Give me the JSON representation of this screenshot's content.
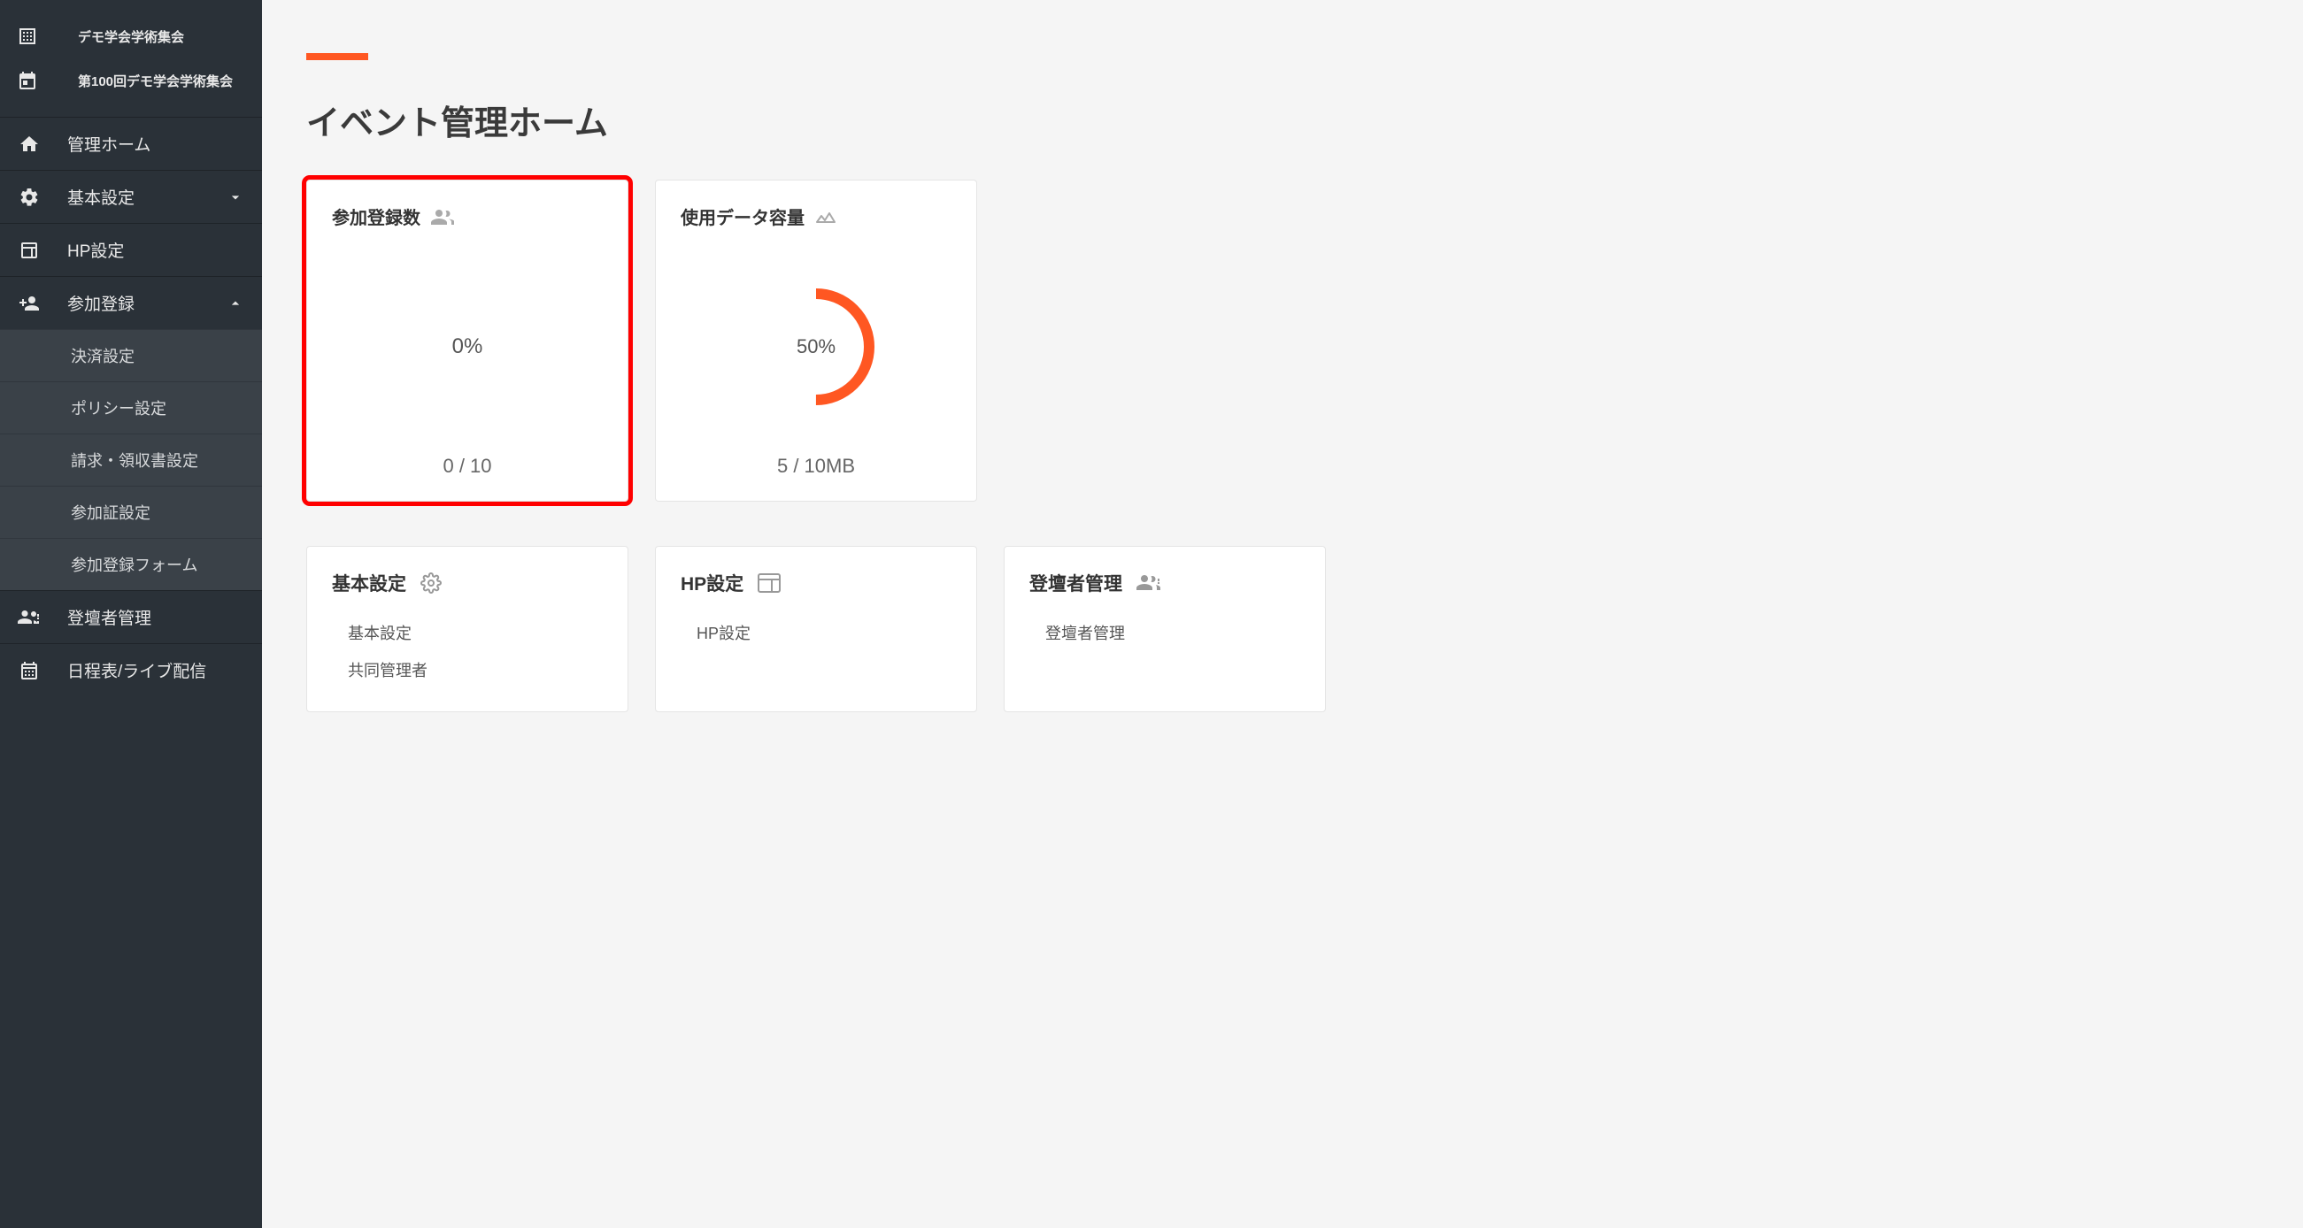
{
  "sidebar": {
    "org_name": "デモ学会学術集会",
    "event_name": "第100回デモ学会学術集会",
    "nav": [
      {
        "label": "管理ホーム",
        "icon": "home"
      },
      {
        "label": "基本設定",
        "icon": "gear",
        "expandable": true,
        "expanded": false
      },
      {
        "label": "HP設定",
        "icon": "web"
      },
      {
        "label": "参加登録",
        "icon": "person-plus",
        "expandable": true,
        "expanded": true,
        "children": [
          {
            "label": "決済設定"
          },
          {
            "label": "ポリシー設定"
          },
          {
            "label": "請求・領収書設定"
          },
          {
            "label": "参加証設定"
          },
          {
            "label": "参加登録フォーム"
          }
        ]
      },
      {
        "label": "登壇者管理",
        "icon": "speakers"
      },
      {
        "label": "日程表/ライブ配信",
        "icon": "calendar"
      }
    ]
  },
  "page": {
    "title": "イベント管理ホーム"
  },
  "cards": {
    "registrations": {
      "title": "参加登録数",
      "percent": "0%",
      "ratio": "0 / 10"
    },
    "storage": {
      "title": "使用データ容量",
      "percent": "50%",
      "ratio": "5 / 10MB",
      "gauge_value": 50
    }
  },
  "link_cards": [
    {
      "title": "基本設定",
      "icon": "gear",
      "links": [
        "基本設定",
        "共同管理者"
      ]
    },
    {
      "title": "HP設定",
      "icon": "web",
      "links": [
        "HP設定"
      ]
    },
    {
      "title": "登壇者管理",
      "icon": "speakers",
      "links": [
        "登壇者管理"
      ]
    }
  ]
}
